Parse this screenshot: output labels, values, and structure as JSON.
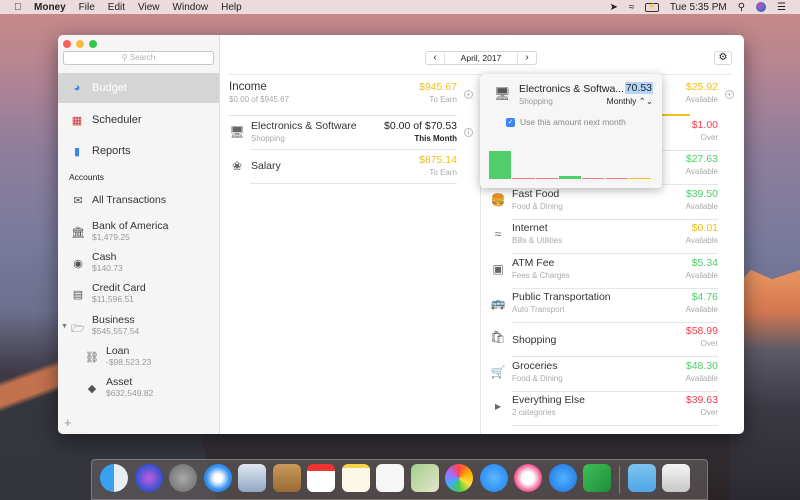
{
  "menubar": {
    "apple_icon": "apple-icon",
    "app": "Money",
    "menus": [
      "File",
      "Edit",
      "View",
      "Window",
      "Help"
    ],
    "battery": "⚡",
    "clock": "Tue 5:35 PM"
  },
  "window": {
    "search_placeholder": "Search",
    "nav": [
      {
        "label": "Budget",
        "icon": "budget-icon"
      },
      {
        "label": "Scheduler",
        "icon": "calendar-icon"
      },
      {
        "label": "Reports",
        "icon": "bar-chart-icon"
      }
    ],
    "accounts_title": "Accounts",
    "accounts": [
      {
        "name": "All Transactions",
        "balance": ""
      },
      {
        "name": "Bank of America",
        "balance": "$1,479.25"
      },
      {
        "name": "Cash",
        "balance": "$140.73"
      },
      {
        "name": "Credit Card",
        "balance": "$11,596.51"
      },
      {
        "name": "Business",
        "balance": "$545,557.54"
      },
      {
        "name": "Loan",
        "balance": "-$98,523.23"
      },
      {
        "name": "Asset",
        "balance": "$632,549.82"
      }
    ],
    "date": "April, 2017",
    "income": {
      "title": "Income",
      "sub": "$0.00 of $945.67",
      "amount": "$945.67",
      "label": "To Earn",
      "items": [
        {
          "name": "Electronics & Software",
          "category": "Shopping",
          "amount": "$0.00 of $70.53",
          "label": "This Month"
        },
        {
          "name": "Salary",
          "category": "",
          "amount": "$875.14",
          "label": "To Earn"
        }
      ]
    },
    "expenses": {
      "amount": "$25.92",
      "label": "Available",
      "items": [
        {
          "name": "",
          "category": "",
          "amount": "$1.00",
          "label": "Over",
          "color": "red"
        },
        {
          "name": "",
          "category": "",
          "amount": "$27.63",
          "label": "Available",
          "color": "green"
        },
        {
          "name": "Fast Food",
          "category": "Food & Dining",
          "amount": "$39.50",
          "label": "Available",
          "color": "green"
        },
        {
          "name": "Internet",
          "category": "Bills & Utilities",
          "amount": "$0.01",
          "label": "Available",
          "color": "yellow"
        },
        {
          "name": "ATM Fee",
          "category": "Fees & Charges",
          "amount": "$5.34",
          "label": "Available",
          "color": "green"
        },
        {
          "name": "Public Transportation",
          "category": "Auto Transport",
          "amount": "$4.76",
          "label": "Available",
          "color": "green"
        },
        {
          "name": "Shopping",
          "category": "",
          "amount": "$58.99",
          "label": "Over",
          "color": "red"
        },
        {
          "name": "Groceries",
          "category": "Food & Dining",
          "amount": "$48.30",
          "label": "Available",
          "color": "green"
        },
        {
          "name": "Everything Else",
          "category": "2 categories",
          "amount": "$39.63",
          "label": "Over",
          "color": "red"
        }
      ]
    },
    "popover": {
      "title": "Electronics & Softwa...",
      "category": "Shopping",
      "value": "70.53",
      "frequency": "Monthly ⌃⌄",
      "checkbox_label": "Use this amount next month",
      "checked": true,
      "history": [
        {
          "value": 1.0,
          "color": "#4fce6a"
        },
        {
          "value": 0,
          "color": "#f07a80"
        },
        {
          "value": 0,
          "color": "#f07a80"
        },
        {
          "value": 0.1,
          "color": "#4fce6a"
        },
        {
          "value": 0,
          "color": "#f07a80"
        },
        {
          "value": 0,
          "color": "#f07a80"
        },
        {
          "value": 0,
          "color": "#f0bf18"
        }
      ]
    }
  },
  "colors": {
    "yellow": "#f0bf18",
    "green": "#4fce6a",
    "red": "#f03d4d",
    "accent": "#3b86f2"
  },
  "dock": [
    "Finder",
    "Siri",
    "Launchpad",
    "Safari",
    "Mail",
    "Contacts",
    "Calendar",
    "Notes",
    "Reminders",
    "Maps",
    "Photos",
    "Messages",
    "iTunes",
    "App Store",
    "Money",
    "Downloads",
    "Trash"
  ]
}
